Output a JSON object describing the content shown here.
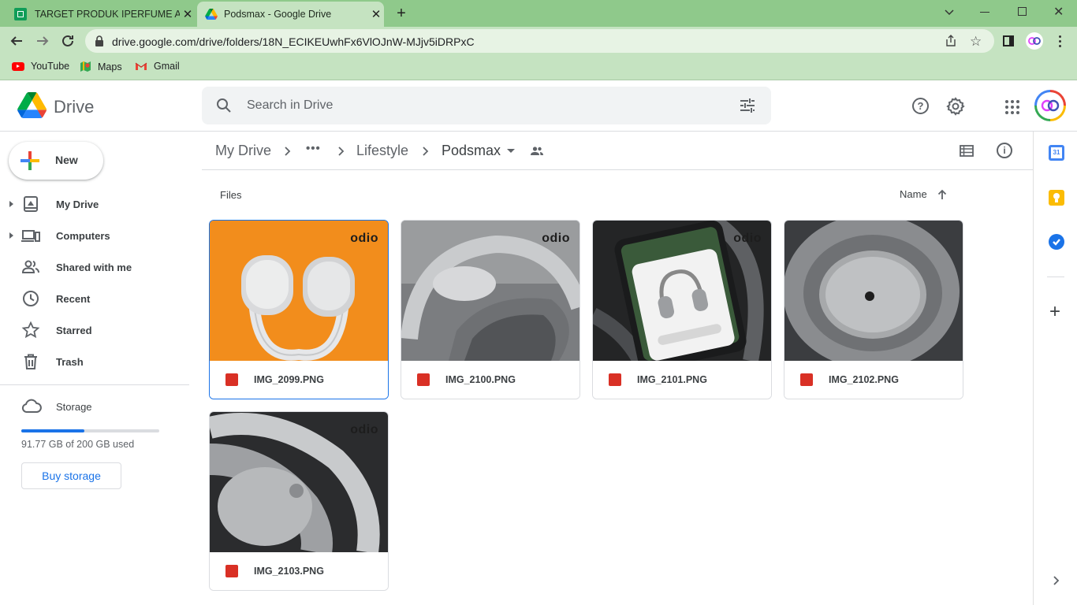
{
  "browser": {
    "tabs": [
      {
        "title": "TARGET PRODUK IPERFUME AGU",
        "active": false
      },
      {
        "title": "Podsmax - Google Drive",
        "active": true
      }
    ],
    "url": "drive.google.com/drive/folders/18N_ECIKEUwhFx6VlOJnW-MJjv5iDRPxC",
    "bookmarks": [
      "YouTube",
      "Maps",
      "Gmail"
    ]
  },
  "app": {
    "name": "Drive",
    "search_placeholder": "Search in Drive"
  },
  "sidebar": {
    "new_label": "New",
    "items": [
      {
        "label": "My Drive",
        "icon": "my-drive-icon",
        "expandable": true
      },
      {
        "label": "Computers",
        "icon": "computers-icon",
        "expandable": true
      },
      {
        "label": "Shared with me",
        "icon": "shared-icon",
        "expandable": false
      },
      {
        "label": "Recent",
        "icon": "recent-clock-icon",
        "expandable": false
      },
      {
        "label": "Starred",
        "icon": "star-icon",
        "expandable": false
      },
      {
        "label": "Trash",
        "icon": "trash-icon",
        "expandable": false
      }
    ],
    "storage": {
      "label": "Storage",
      "used_text": "91.77 GB of 200 GB used",
      "used_fraction": 0.459,
      "buy_label": "Buy storage"
    }
  },
  "breadcrumb": {
    "items": [
      "My Drive",
      "•••",
      "Lifestyle",
      "Podsmax"
    ]
  },
  "files": {
    "section_label": "Files",
    "sort_label": "Name",
    "items": [
      {
        "name": "IMG_2099.PNG",
        "selected": true,
        "brand": "odio"
      },
      {
        "name": "IMG_2100.PNG",
        "selected": false,
        "brand": "odio"
      },
      {
        "name": "IMG_2101.PNG",
        "selected": false,
        "brand": "odio"
      },
      {
        "name": "IMG_2102.PNG",
        "selected": false,
        "brand": ""
      },
      {
        "name": "IMG_2103.PNG",
        "selected": false,
        "brand": "odio"
      }
    ]
  },
  "colors": {
    "accent": "#1a73e8",
    "browser_frame": "#8fc98b",
    "browser_toolbar": "#c5e3c1",
    "image_file_icon": "#d93025"
  },
  "side_panel": {
    "calendar_day": "31"
  }
}
